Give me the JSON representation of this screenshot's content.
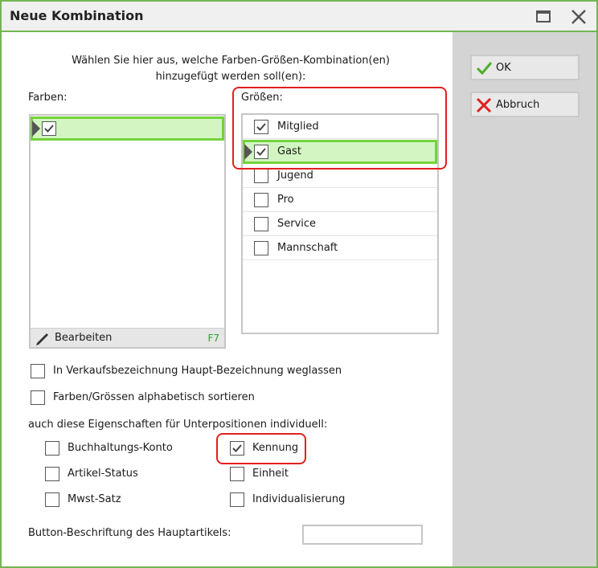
{
  "window": {
    "title": "Neue Kombination"
  },
  "titlebar": {
    "maximize_icon": "maximize-icon",
    "close_icon": "close-icon"
  },
  "actions": {
    "ok_label": "OK",
    "cancel_label": "Abbruch",
    "ok_icon": "checkmark-icon",
    "cancel_icon": "x-icon",
    "ok_icon_color": "#4caf28",
    "cancel_icon_color": "#e02020"
  },
  "instruction": {
    "line1": "Wählen Sie hier aus, welche Farben-Größen-Kombination(en)",
    "line2": "hinzugefügt werden soll(en):"
  },
  "colors": {
    "label": "Farben:",
    "items": [
      {
        "label": "",
        "checked": true,
        "selected": true
      }
    ],
    "edit_label": "Bearbeiten",
    "edit_shortcut": "F7"
  },
  "sizes": {
    "label": "Größen:",
    "items": [
      {
        "label": "Mitglied",
        "checked": true,
        "selected": false
      },
      {
        "label": "Gast",
        "checked": true,
        "selected": true
      },
      {
        "label": "Jugend",
        "checked": false,
        "selected": false
      },
      {
        "label": "Pro",
        "checked": false,
        "selected": false
      },
      {
        "label": "Service",
        "checked": false,
        "selected": false
      },
      {
        "label": "Mannschaft",
        "checked": false,
        "selected": false
      }
    ]
  },
  "options": {
    "omit_main_name": {
      "label": "In Verkaufsbezeichnung Haupt-Bezeichnung weglassen",
      "checked": false
    },
    "sort_alpha": {
      "label": "Farben/Grössen alphabetisch sortieren",
      "checked": false
    }
  },
  "subpositions": {
    "heading": "auch diese Eigenschaften für Unterpositionen individuell:",
    "items": [
      {
        "label": "Buchhaltungs-Konto",
        "checked": false
      },
      {
        "label": "Kennung",
        "checked": true
      },
      {
        "label": "Artikel-Status",
        "checked": false
      },
      {
        "label": "Einheit",
        "checked": false
      },
      {
        "label": "Mwst-Satz",
        "checked": false
      },
      {
        "label": "Individualisierung",
        "checked": false
      }
    ]
  },
  "main_button": {
    "label": "Button-Beschriftung des Hauptartikels:",
    "value": ""
  },
  "theme": {
    "accent": "#73b556",
    "selection_bg": "#d2f5c2",
    "selection_border": "#74d23a",
    "annotation": "#e02020"
  }
}
